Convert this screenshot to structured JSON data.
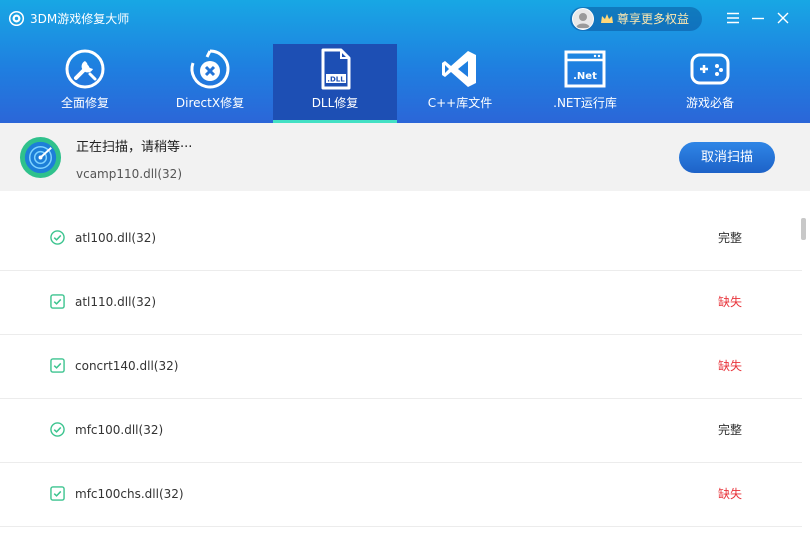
{
  "app": {
    "title": "3DM游戏修复大师"
  },
  "vip": {
    "label": "尊享更多权益"
  },
  "tabs": [
    {
      "label": "全面修复",
      "icon": "wrench-icon"
    },
    {
      "label": "DirectX修复",
      "icon": "directx-icon"
    },
    {
      "label": "DLL修复",
      "icon": "dll-file-icon",
      "active": true
    },
    {
      "label": "C++库文件",
      "icon": "visual-studio-icon"
    },
    {
      ".net_label": "",
      "label": ".NET运行库",
      "icon": "net-window-icon"
    },
    {
      "label": "游戏必备",
      "icon": "gamepad-icon"
    }
  ],
  "scan": {
    "title": "正在扫描，请稍等···",
    "current_file": "vcamp110.dll(32)",
    "cancel_label": "取消扫描"
  },
  "files": [
    {
      "name": "atl100.dll(32)",
      "status": "完整",
      "state": "ok"
    },
    {
      "name": "atl110.dll(32)",
      "status": "缺失",
      "state": "missing"
    },
    {
      "name": "concrt140.dll(32)",
      "status": "缺失",
      "state": "missing"
    },
    {
      "name": "mfc100.dll(32)",
      "status": "完整",
      "state": "ok"
    },
    {
      "name": "mfc100chs.dll(32)",
      "status": "缺失",
      "state": "missing"
    }
  ],
  "colors": {
    "header_top": "#18a7e4",
    "header_bottom": "#2b66d8",
    "accent_green": "#3cc48f",
    "missing_red": "#e8343b",
    "active_underline": "#43e0c4"
  }
}
